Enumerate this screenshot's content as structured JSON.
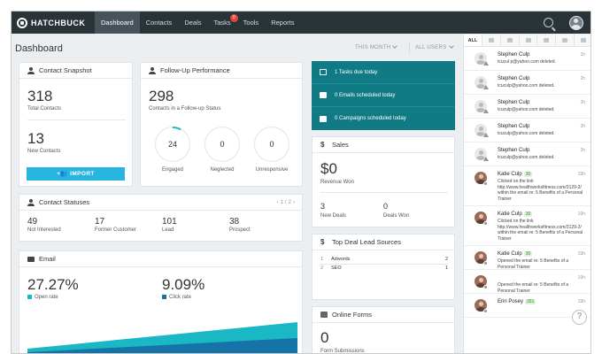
{
  "brand": {
    "name": "HATCHBUCK"
  },
  "nav": {
    "items": [
      {
        "label": "Dashboard",
        "active": true
      },
      {
        "label": "Contacts"
      },
      {
        "label": "Deals"
      },
      {
        "label": "Tasks",
        "badge": "0"
      },
      {
        "label": "Tools"
      },
      {
        "label": "Reports"
      }
    ]
  },
  "header": {
    "title": "Dashboard",
    "period_filter": "THIS MONTH",
    "user_filter": "ALL USERS"
  },
  "contact_snapshot": {
    "title": "Contact Snapshot",
    "total_value": "318",
    "total_label": "Total Contacts",
    "new_value": "13",
    "new_label": "New Contacts",
    "import_label": "IMPORT"
  },
  "follow_up": {
    "title": "Follow-Up Performance",
    "value": "298",
    "label": "Contacts in a Follow-up Status",
    "rings": [
      {
        "value": "24",
        "label": "Engaged",
        "fill_fraction": 0.08
      },
      {
        "value": "0",
        "label": "Neglected",
        "fill_fraction": 0
      },
      {
        "value": "0",
        "label": "Unresponsive",
        "fill_fraction": 0
      }
    ]
  },
  "schedule": {
    "rows": [
      {
        "label": "1 Tasks due today"
      },
      {
        "label": "0 Emails scheduled today"
      },
      {
        "label": "0 Campaigns scheduled today"
      }
    ]
  },
  "sales": {
    "title": "Sales",
    "revenue_value": "$0",
    "revenue_label": "Revenue Won",
    "new_deals_value": "3",
    "new_deals_label": "New Deals",
    "deals_won_value": "0",
    "deals_won_label": "Deals Won"
  },
  "contact_statuses": {
    "title": "Contact Statuses",
    "pagination": "1 / 2",
    "items": [
      {
        "value": "49",
        "label": "Not Interested"
      },
      {
        "value": "17",
        "label": "Former Customer"
      },
      {
        "value": "101",
        "label": "Lead"
      },
      {
        "value": "38",
        "label": "Prospect"
      }
    ]
  },
  "lead_sources": {
    "title": "Top Deal Lead Sources",
    "rows": [
      {
        "index": "1",
        "name": "Adwords",
        "count": "2"
      },
      {
        "index": "2",
        "name": "SEO",
        "count": "1"
      }
    ]
  },
  "email": {
    "title": "Email",
    "open_rate_value": "27.27%",
    "open_rate_label": "Open rate",
    "click_rate_value": "9.09%",
    "click_rate_label": "Click rate",
    "colors": {
      "open": "#1ab7c4",
      "click": "#1673a8"
    }
  },
  "online_forms": {
    "title": "Online Forms",
    "value": "0",
    "label": "Form Submissions"
  },
  "feed": {
    "tabs": [
      {
        "label": "ALL",
        "active": true
      },
      {
        "icon": "list-icon"
      },
      {
        "icon": "envelope-icon"
      },
      {
        "icon": "message-icon"
      },
      {
        "icon": "calendar-icon"
      },
      {
        "icon": "pointer-icon"
      },
      {
        "icon": "alert-icon"
      }
    ],
    "items": [
      {
        "name": "Stephen Culp",
        "time": "1h",
        "text": "tcucul p@yahoo.com deleted."
      },
      {
        "name": "Stephen Culp",
        "time": "2h",
        "text": "tcuculp@yahoo.com deleted."
      },
      {
        "name": "Stephen Culp",
        "time": "2h",
        "text": "tcuculp@yahoo.com deleted."
      },
      {
        "name": "Stephen Culp",
        "time": "2h",
        "text": "tcuculp@yahoo.com deleted."
      },
      {
        "name": "Stephen Culp",
        "time": "2h",
        "text": "tcuculp@yahoo.com deleted."
      },
      {
        "name": "Katie Culp",
        "score": "30",
        "time": "19h",
        "text": "Clicked on the link http://www.healthworksfitness.com/3129-2/ within the email re: 5 Benefits of a Personal Trainer",
        "tall": true,
        "photo": true
      },
      {
        "name": "Katie Culp",
        "score": "30",
        "time": "19h",
        "text": "Clicked on the link http://www.healthworksfitness.com/3129-2/ within the email re: 5 Benefits of a Personal Trainer",
        "tall": true,
        "photo": true
      },
      {
        "name": "Katie Culp",
        "score": "30",
        "time": "19h",
        "text": "Opened the email re: 5 Benefits of a Personal Trainer",
        "photo": true
      },
      {
        "name": "",
        "time": "19h",
        "text": "Opened the email re: 5 Benefits of a Personal Trainer",
        "photo": true
      },
      {
        "name": "Erin Posey",
        "score": "391",
        "time": "19h",
        "text": "",
        "photo": true
      }
    ]
  },
  "help": {
    "label": "?"
  }
}
